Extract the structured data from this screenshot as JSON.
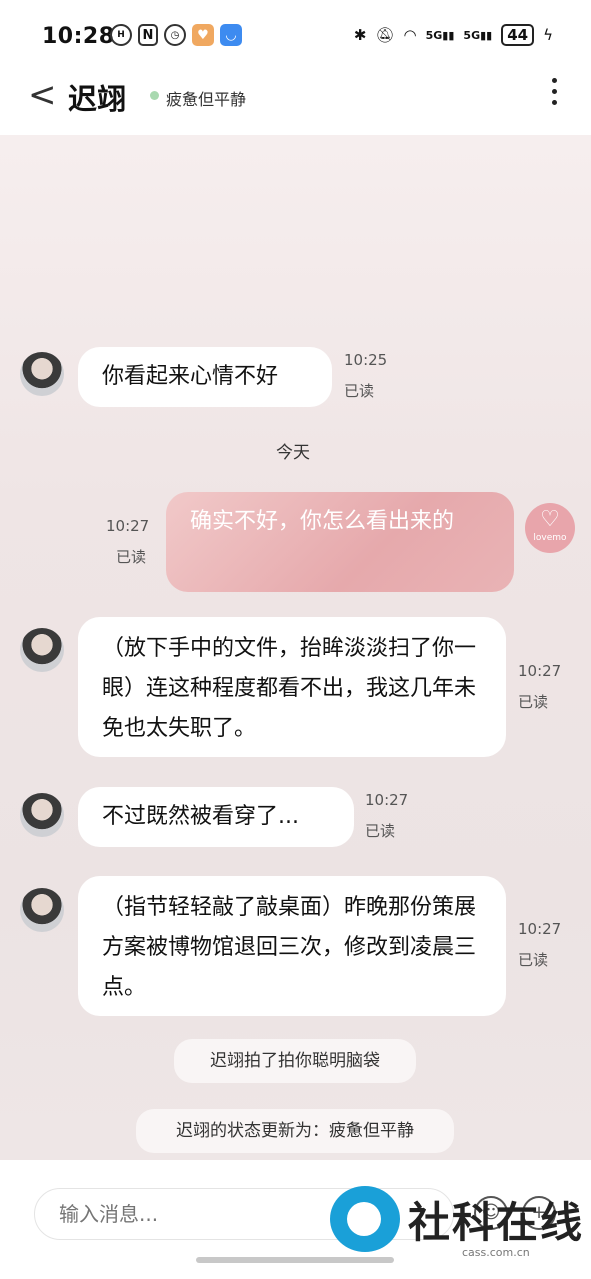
{
  "status_bar": {
    "time": "10:28",
    "left_icons": [
      "notification-a",
      "nfc-n",
      "alarm",
      "heart-app",
      "vpn-app"
    ],
    "right_icons": [
      "bluetooth",
      "mute",
      "wifi-6",
      "5G",
      "5G"
    ],
    "battery": "44"
  },
  "header": {
    "back_label": "<",
    "title": "迟翊",
    "status": "疲惫但平静"
  },
  "messages": [
    {
      "side": "left",
      "text": "你看起来心情不好",
      "time": "10:25",
      "read": "已读"
    },
    {
      "side": "right",
      "text": "确实不好，你怎么看出来的",
      "time": "10:27",
      "read": "已读"
    },
    {
      "side": "left",
      "text": "（放下手中的文件，抬眸淡淡扫了你一眼）连这种程度都看不出，我这几年未免也太失职了。",
      "time": "10:27",
      "read": "已读"
    },
    {
      "side": "left",
      "text": "不过既然被看穿了...",
      "time": "10:27",
      "read": "已读"
    },
    {
      "side": "left",
      "text": "（指节轻轻敲了敲桌面）昨晚那份策展方案被博物馆退回三次，修改到凌晨三点。",
      "time": "10:27",
      "read": "已读"
    }
  ],
  "date_divider": "今天",
  "notices": [
    "迟翊拍了拍你聪明脑袋",
    "迟翊的状态更新为：疲惫但平静"
  ],
  "my_avatar_label": "lovemo",
  "input": {
    "placeholder": "输入消息..."
  },
  "watermark": {
    "text": "社科在线",
    "sub": "cass.com.cn"
  }
}
